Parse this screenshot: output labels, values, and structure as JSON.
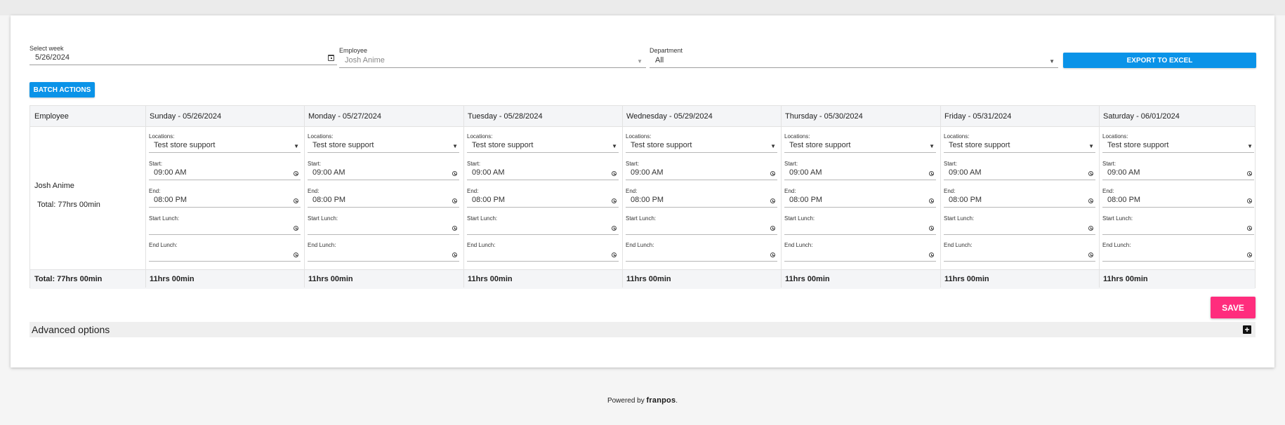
{
  "filters": {
    "week": {
      "label": "Select week",
      "value": "5/26/2024"
    },
    "employee": {
      "label": "Employee",
      "value": "Josh Anime"
    },
    "department": {
      "label": "Department",
      "value": "All"
    },
    "export_label": "EXPORT TO EXCEL",
    "batch_label": "BATCH ACTIONS"
  },
  "table": {
    "employee_header": "Employee",
    "days": [
      {
        "header": "Sunday - 05/26/2024",
        "location": "Test store support",
        "start": "09:00 AM",
        "end": "08:00 PM",
        "start_lunch": "",
        "end_lunch": "",
        "total": "11hrs 00min"
      },
      {
        "header": "Monday - 05/27/2024",
        "location": "Test store support",
        "start": "09:00 AM",
        "end": "08:00 PM",
        "start_lunch": "",
        "end_lunch": "",
        "total": "11hrs 00min"
      },
      {
        "header": "Tuesday - 05/28/2024",
        "location": "Test store support",
        "start": "09:00 AM",
        "end": "08:00 PM",
        "start_lunch": "",
        "end_lunch": "",
        "total": "11hrs 00min"
      },
      {
        "header": "Wednesday - 05/29/2024",
        "location": "Test store support",
        "start": "09:00 AM",
        "end": "08:00 PM",
        "start_lunch": "",
        "end_lunch": "",
        "total": "11hrs 00min"
      },
      {
        "header": "Thursday - 05/30/2024",
        "location": "Test store support",
        "start": "09:00 AM",
        "end": "08:00 PM",
        "start_lunch": "",
        "end_lunch": "",
        "total": "11hrs 00min"
      },
      {
        "header": "Friday - 05/31/2024",
        "location": "Test store support",
        "start": "09:00 AM",
        "end": "08:00 PM",
        "start_lunch": "",
        "end_lunch": "",
        "total": "11hrs 00min"
      },
      {
        "header": "Saturday - 06/01/2024",
        "location": "Test store support",
        "start": "09:00 AM",
        "end": "08:00 PM",
        "start_lunch": "",
        "end_lunch": "",
        "total": "11hrs 00min"
      }
    ],
    "field_labels": {
      "locations": "Locations:",
      "start": "Start:",
      "end": "End:",
      "start_lunch": "Start Lunch:",
      "end_lunch": "End Lunch:"
    },
    "employee_row": {
      "name": "Josh Anime",
      "total": "Total: 77hrs 00min"
    },
    "footer_total": "Total: 77hrs 00min"
  },
  "save_label": "SAVE",
  "advanced_label": "Advanced options",
  "footer": {
    "powered_by": "Powered by",
    "brand": "franpos",
    "dot": "."
  },
  "colors": {
    "primary": "#0a93e8",
    "save": "#ff2d7d"
  }
}
